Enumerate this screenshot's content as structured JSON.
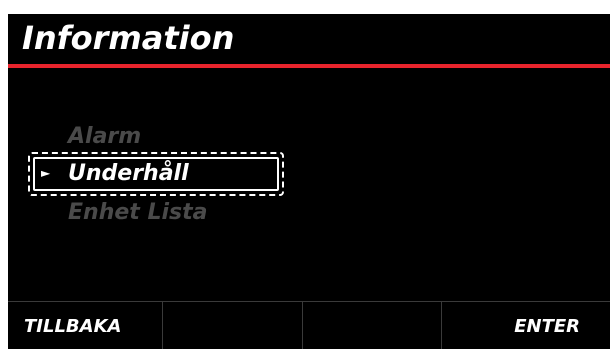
{
  "header": {
    "title": "Information",
    "accent_color": "#e8242c"
  },
  "menu": {
    "items": [
      {
        "label": "Alarm",
        "state": "dimmed"
      },
      {
        "label": "Underhåll",
        "state": "selected"
      },
      {
        "label": "Enhet Lista",
        "state": "dimmed"
      }
    ],
    "selected_index": 1,
    "pointer_icon": "triangle-right-icon"
  },
  "footer": {
    "softkeys": [
      {
        "label": "TILLBAKA"
      },
      {
        "label": ""
      },
      {
        "label": ""
      },
      {
        "label": "ENTER"
      }
    ]
  }
}
